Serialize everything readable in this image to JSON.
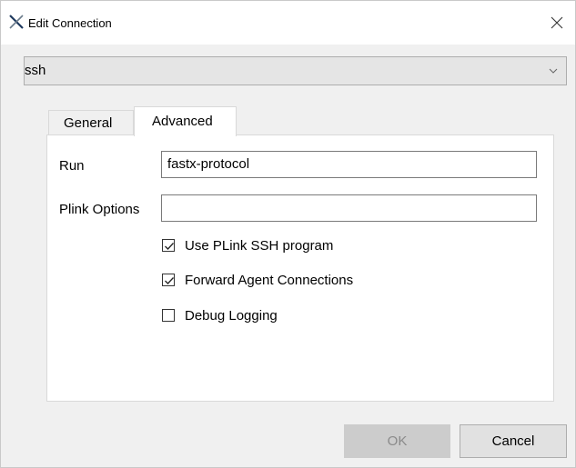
{
  "window": {
    "title": "Edit Connection",
    "app_icon": "fastx-x-icon",
    "close_icon": "close-icon"
  },
  "connection_type": {
    "selected": "ssh"
  },
  "tabs": [
    {
      "label": "General",
      "active": false
    },
    {
      "label": "Advanced",
      "active": true
    }
  ],
  "advanced": {
    "run_label": "Run",
    "run_value": "fastx-protocol",
    "plink_label": "Plink Options",
    "plink_value": "",
    "checkboxes": [
      {
        "label": "Use PLink SSH program",
        "checked": true
      },
      {
        "label": "Forward Agent Connections",
        "checked": true
      },
      {
        "label": "Debug Logging",
        "checked": false
      }
    ]
  },
  "buttons": {
    "ok": "OK",
    "cancel": "Cancel",
    "ok_enabled": false
  }
}
